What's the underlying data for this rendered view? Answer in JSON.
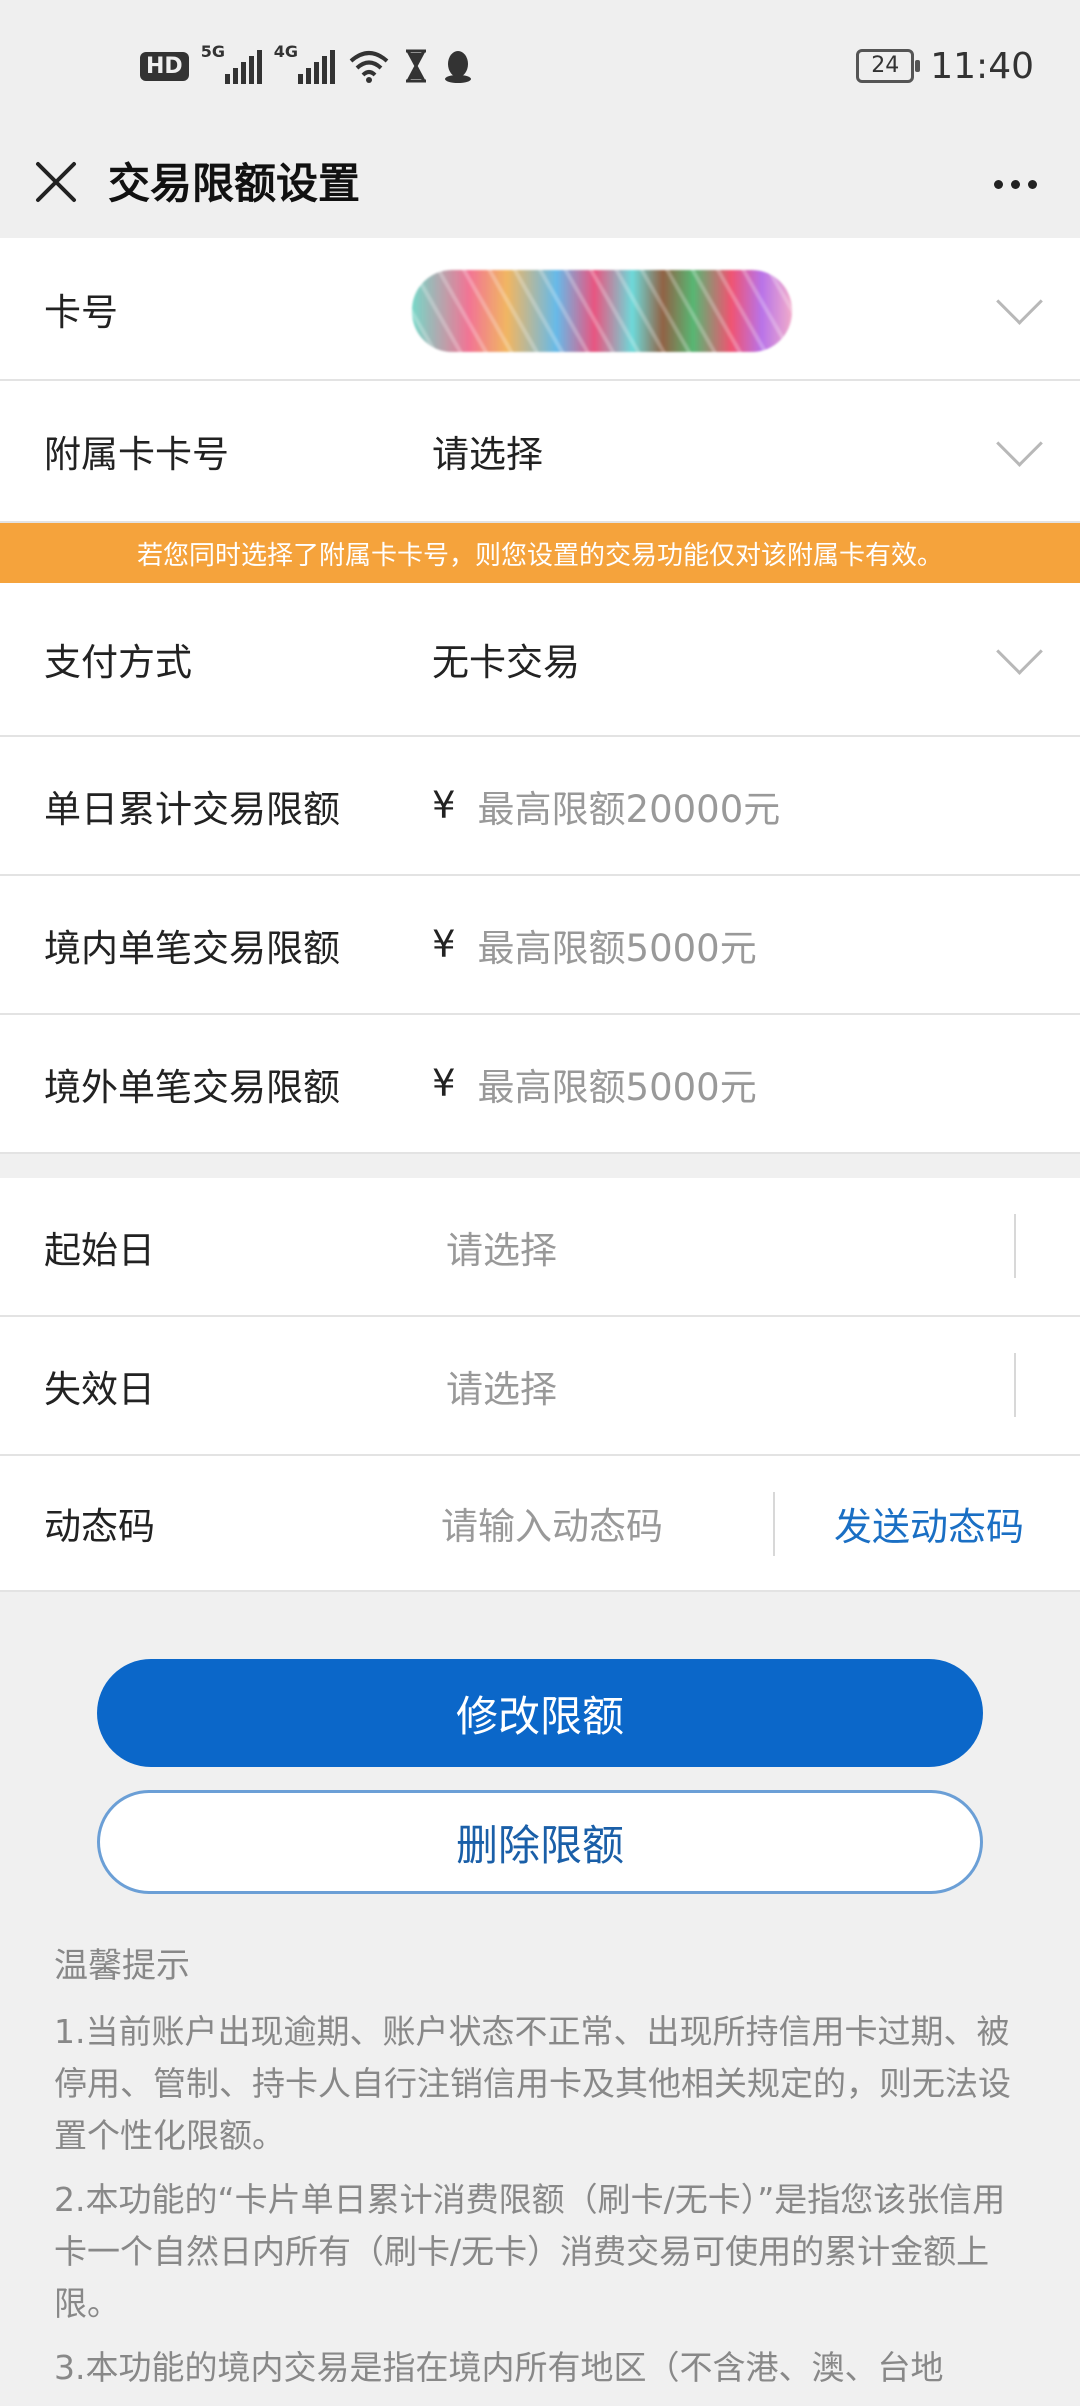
{
  "status_bar": {
    "hd_label": "HD",
    "sim1_label": "5G",
    "sim2_label": "4G",
    "battery": "24",
    "time": "11:40"
  },
  "header": {
    "title": "交易限额设置"
  },
  "form": {
    "card_number": {
      "label": "卡号"
    },
    "sub_card": {
      "label": "附属卡卡号",
      "value": "请选择"
    },
    "notice": "若您同时选择了附属卡卡号，则您设置的交易功能仅对该附属卡有效。",
    "payment_method": {
      "label": "支付方式",
      "value": "无卡交易"
    },
    "daily_limit": {
      "label": "单日累计交易限额",
      "currency": "¥",
      "placeholder": "最高限额20000元"
    },
    "domestic_limit": {
      "label": "境内单笔交易限额",
      "currency": "¥",
      "placeholder": "最高限额5000元"
    },
    "overseas_limit": {
      "label": "境外单笔交易限额",
      "currency": "¥",
      "placeholder": "最高限额5000元"
    },
    "start_date": {
      "label": "起始日",
      "placeholder": "请选择"
    },
    "end_date": {
      "label": "失效日",
      "placeholder": "请选择"
    },
    "otp": {
      "label": "动态码",
      "placeholder": "请输入动态码",
      "send_label": "发送动态码"
    }
  },
  "actions": {
    "modify_label": "修改限额",
    "delete_label": "删除限额"
  },
  "tips": {
    "title": "温馨提示",
    "items": [
      "1.当前账户出现逾期、账户状态不正常、出现所持信用卡过期、被停用、管制、持卡人自行注销信用卡及其他相关规定的，则无法设置个性化限额。",
      "2.本功能的“卡片单日累计消费限额（刷卡/无卡）”是指您该张信用卡一个自然日内所有（刷卡/无卡）消费交易可使用的累计金额上限。",
      "3.本功能的境内交易是指在境内所有地区（不含港、澳、台地"
    ]
  },
  "colors": {
    "primary": "#0b67c9",
    "notice_bg": "#f5a33c",
    "link": "#1a6fc4"
  }
}
